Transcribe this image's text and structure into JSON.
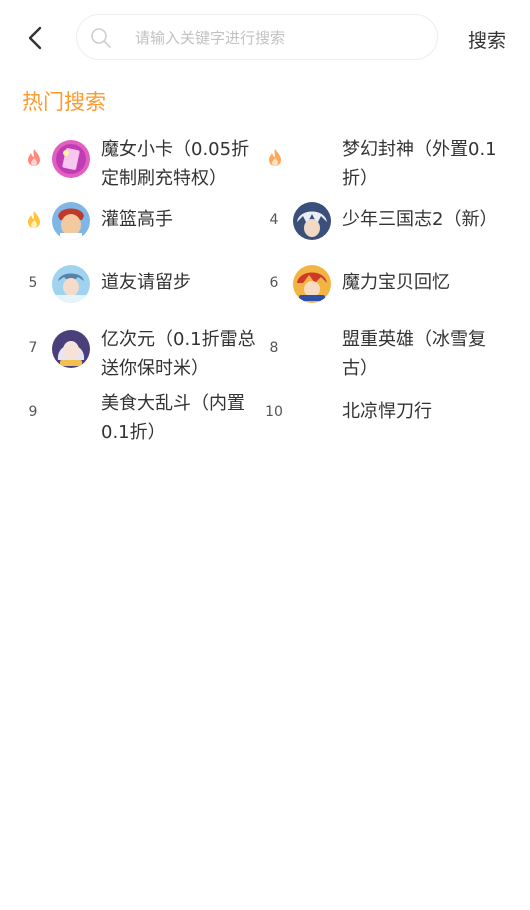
{
  "header": {
    "back_icon": "chevron-left-icon",
    "search_icon": "search-icon",
    "search_placeholder": "请输入关键字进行搜索",
    "search_value": "",
    "search_button_label": "搜索"
  },
  "hot_search": {
    "title": "热门搜索",
    "accent_color": "#ff9a2a",
    "items": [
      {
        "rank": "1",
        "rank_icon": "fire-red-icon",
        "name": "魔女小卡（0.05折定制刷充特权）",
        "has_icon": true
      },
      {
        "rank": "2",
        "rank_icon": "fire-orange-icon",
        "name": "梦幻封神（外置0.1折）",
        "has_icon": false
      },
      {
        "rank": "3",
        "rank_icon": "fire-yellow-icon",
        "name": "灌篮高手",
        "has_icon": true
      },
      {
        "rank": "4",
        "rank_icon": "",
        "name": "少年三国志2（新）",
        "has_icon": true
      },
      {
        "rank": "5",
        "rank_icon": "",
        "name": "道友请留步",
        "has_icon": true
      },
      {
        "rank": "6",
        "rank_icon": "",
        "name": "魔力宝贝回忆",
        "has_icon": true
      },
      {
        "rank": "7",
        "rank_icon": "",
        "name": "亿次元（0.1折雷总送你保时米）",
        "has_icon": true
      },
      {
        "rank": "8",
        "rank_icon": "",
        "name": "盟重英雄（冰雪复古）",
        "has_icon": false
      },
      {
        "rank": "9",
        "rank_icon": "",
        "name": "美食大乱斗（内置0.1折）",
        "has_icon": false
      },
      {
        "rank": "10",
        "rank_icon": "",
        "name": "北凉悍刀行",
        "has_icon": false
      }
    ]
  }
}
